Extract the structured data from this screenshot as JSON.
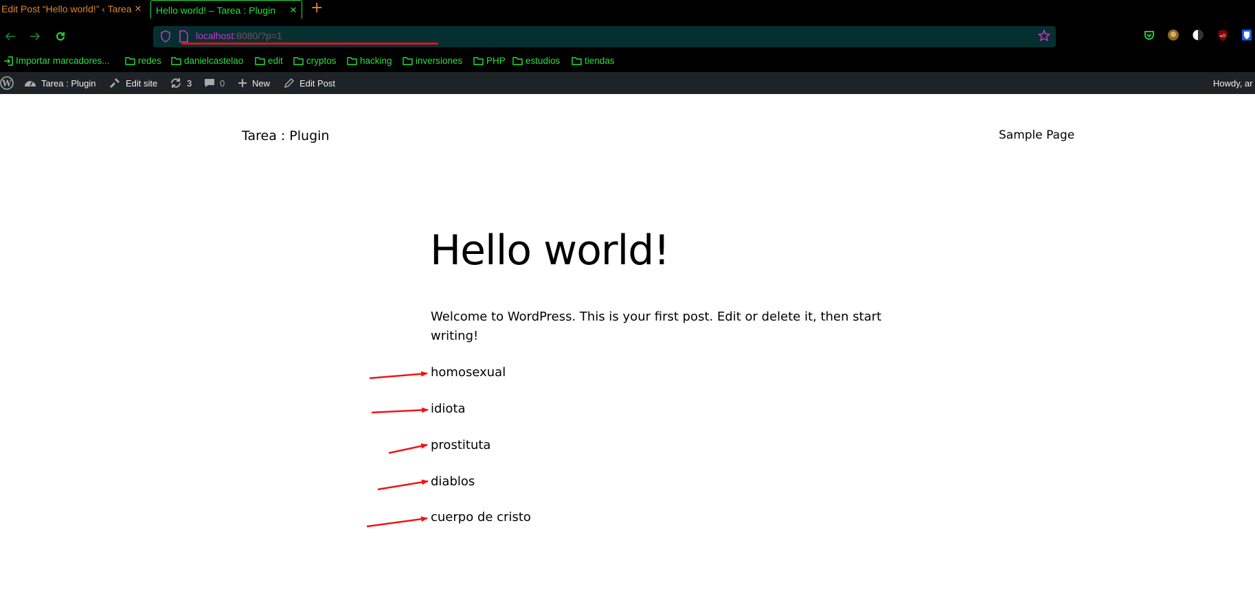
{
  "browser": {
    "tabs": [
      {
        "title": "Edit Post “Hello world!” ‹ Tarea",
        "active": false
      },
      {
        "title": "Hello world! – Tarea : Plugin",
        "active": true
      }
    ],
    "new_tab": "+",
    "url": {
      "host": "localhost",
      "rest": ":8080/?p=1"
    },
    "bookmarks": [
      {
        "label": "Importar marcadores...",
        "icon": "import-icon"
      },
      {
        "label": "redes",
        "icon": "folder-icon"
      },
      {
        "label": "danielcastelao",
        "icon": "folder-icon"
      },
      {
        "label": "edit",
        "icon": "folder-icon"
      },
      {
        "label": "cryptos",
        "icon": "folder-icon"
      },
      {
        "label": "hacking",
        "icon": "folder-icon"
      },
      {
        "label": "inversiones",
        "icon": "folder-icon"
      },
      {
        "label": "PHP",
        "icon": "folder-icon"
      },
      {
        "label": "estudios",
        "icon": "folder-icon"
      },
      {
        "label": "tiendas",
        "icon": "folder-icon"
      }
    ],
    "accent_color": "#22e33a",
    "inactive_tab_color": "#e0852f"
  },
  "adminbar": {
    "site_name": "Tarea : Plugin",
    "edit_site": "Edit site",
    "updates_count": "3",
    "comments_count": "0",
    "new_label": "New",
    "edit_post": "Edit Post",
    "howdy": "Howdy, ar"
  },
  "site": {
    "title": "Tarea : Plugin",
    "nav_item": "Sample Page"
  },
  "post": {
    "title": "Hello world!",
    "body": "Welcome to WordPress. This is your first post. Edit or delete it, then start writing!",
    "words": [
      "homosexual",
      "idiota",
      "prostituta",
      "diablos",
      "cuerpo de cristo"
    ]
  },
  "annotation_color": "#f01414"
}
